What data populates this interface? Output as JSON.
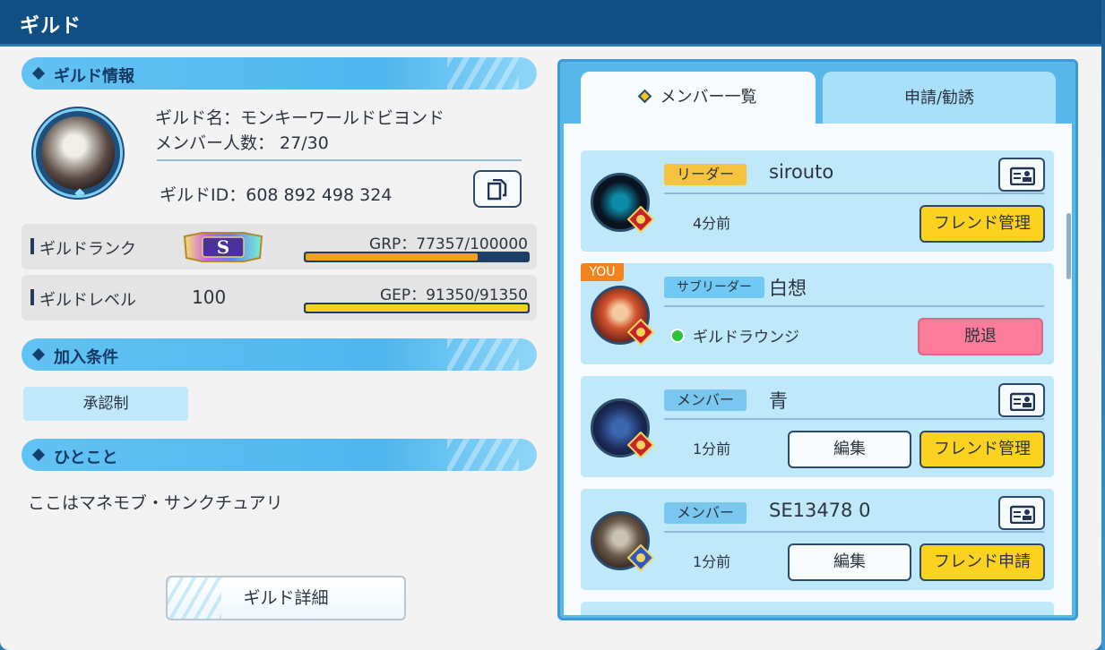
{
  "header": {
    "title": "ギルド"
  },
  "guild_info": {
    "section_title": "ギルド情報",
    "name_line": "ギルド名：モンキーワールドビヨンド",
    "members_line": "メンバー人数： 27/30",
    "id_line": "ギルドID：608 892 498 324"
  },
  "rank": {
    "label": "ギルドランク",
    "badge_letter": "S",
    "bar_label": "GRP：77357/100000",
    "progress": 0.774
  },
  "level": {
    "label": "ギルドレベル",
    "value": "100",
    "bar_label": "GEP：91350/91350",
    "progress": 1.0
  },
  "join": {
    "section_title": "加入条件",
    "condition": "承認制"
  },
  "comment": {
    "section_title": "ひとこと",
    "text": "ここはマネモブ・サンクチュアリ"
  },
  "detail_button": "ギルド詳細",
  "tabs": {
    "members": "メンバー一覧",
    "requests": "申請/勧誘"
  },
  "members": [
    {
      "role": "リーダー",
      "name": "sirouto",
      "time": "4分前",
      "action": "フレンド管理",
      "avatar_color": "#0a1420"
    },
    {
      "badge": "YOU",
      "role": "サブリーダー",
      "name": "白想",
      "status": "ギルドラウンジ",
      "action": "脱退",
      "avatar_color": "#c1402e"
    },
    {
      "role": "メンバー",
      "name": "青",
      "time": "1分前",
      "edit": "編集",
      "action": "フレンド管理",
      "avatar_color": "#1d2d5a"
    },
    {
      "role": "メンバー",
      "name": "SE13478 0",
      "time": "1分前",
      "edit": "編集",
      "action": "フレンド申請",
      "avatar_color": "#3e2a26"
    }
  ],
  "colors": {
    "header": "#0f4f84",
    "accent_blue": "#58b7ea",
    "yellow_button": "#fbd21f",
    "pink_button": "#fa7c9a",
    "grp_bar": "#f4a11a",
    "gep_bar": "#f7d21c"
  }
}
